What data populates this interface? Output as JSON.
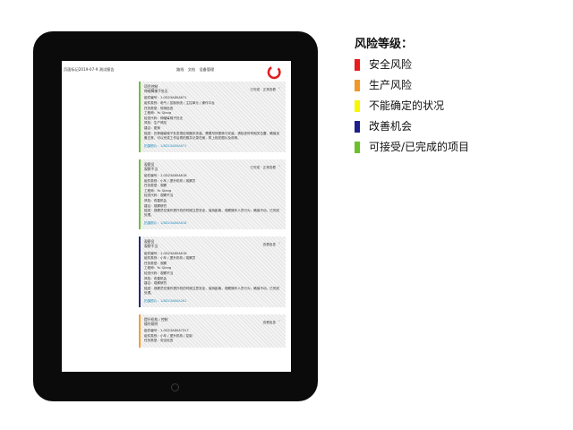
{
  "header": {
    "left_text": "页面标记2019-07-9 测试报告",
    "nav": [
      "路线",
      "文档",
      "设备管理"
    ],
    "logo_icon": "ring-logo-icon",
    "logo_color": "#e02020"
  },
  "cards": [
    {
      "stripe_color": "#6fbf3c",
      "title": "项目控制",
      "subtitle": "伸缩臂梯子处无",
      "status": "已完成 · 正常查看",
      "lines": [
        "组件编号：1-0D23A80A671",
        "组件类别：电气 / 控制系统 / 主控单元 / 操作平台",
        "任务类型：现场检查",
        "工程师：Yu Qiang",
        "检查代码：伸缩臂梯子处无",
        "风险：生产风险",
        "建议：更换"
      ],
      "note": "描述：在伸缩臂梯子处发现检测器未安装，需要尽快更换与安装。请检查所有相关位置，确保设备正常，可以完成工作后再拍照并记录在案，附上相关图片及说明。",
      "photos": "拍摄照片：1/8D23A80A671",
      "tall": true
    },
    {
      "stripe_color": "#6fbf3c",
      "title": "观察员",
      "subtitle": "观察不当",
      "status": "已完成 · 正常查看",
      "lines": [
        "组件编号：1-0D23A80A618",
        "组件类别：小车 / 提升机构 / 观察员",
        "任务类型：观察",
        "工程师：Yu Qiang",
        "检查代码：观察不当",
        "风险：改善机会",
        "建议：观察研究"
      ],
      "note": "描述：观察员在操作提升机的时候注意安全，保持距离，观察操作人员行为，确保不动，已完成处理。",
      "photos": "拍摄照片：1/8D23A80A618",
      "tall": false
    },
    {
      "stripe_color": "#232a7a",
      "title": "观察员",
      "subtitle": "观察不当",
      "status": "查看信息",
      "lines": [
        "组件编号：1-0D23A80A618",
        "组件类别：小车 / 提升机构 / 观察员",
        "任务类型：观察",
        "工程师：Yu Qiang",
        "检查代码：观察不当",
        "风险：改善机会",
        "建议：观察研究"
      ],
      "note": "描述：观察员在操作提升机的时候注意安全，保持距离，观察操作人员行为，确保不动，已完成处理。",
      "photos": "拍摄照片：1/8D23A80A261",
      "tall": false
    },
    {
      "stripe_color": "#f2a03a",
      "title": "提升机构 / 控制",
      "subtitle": "操作照明",
      "status": "查看信息",
      "lines": [
        "组件编号：1-0D23A80A7317",
        "组件类别：小车 / 提升机构 / 控制",
        "任务类型：安全检查"
      ],
      "note": "",
      "photos": "",
      "tall": false
    }
  ],
  "legend": {
    "title": "风险等级：",
    "items": [
      {
        "label": "安全风险",
        "color": "#e81c1c"
      },
      {
        "label": "生产风险",
        "color": "#f2982a"
      },
      {
        "label": "不能确定的状况",
        "color": "#f7f700"
      },
      {
        "label": "改善机会",
        "color": "#1e1f8a"
      },
      {
        "label": "可接受/已完成的项目",
        "color": "#6cc12b"
      }
    ]
  }
}
